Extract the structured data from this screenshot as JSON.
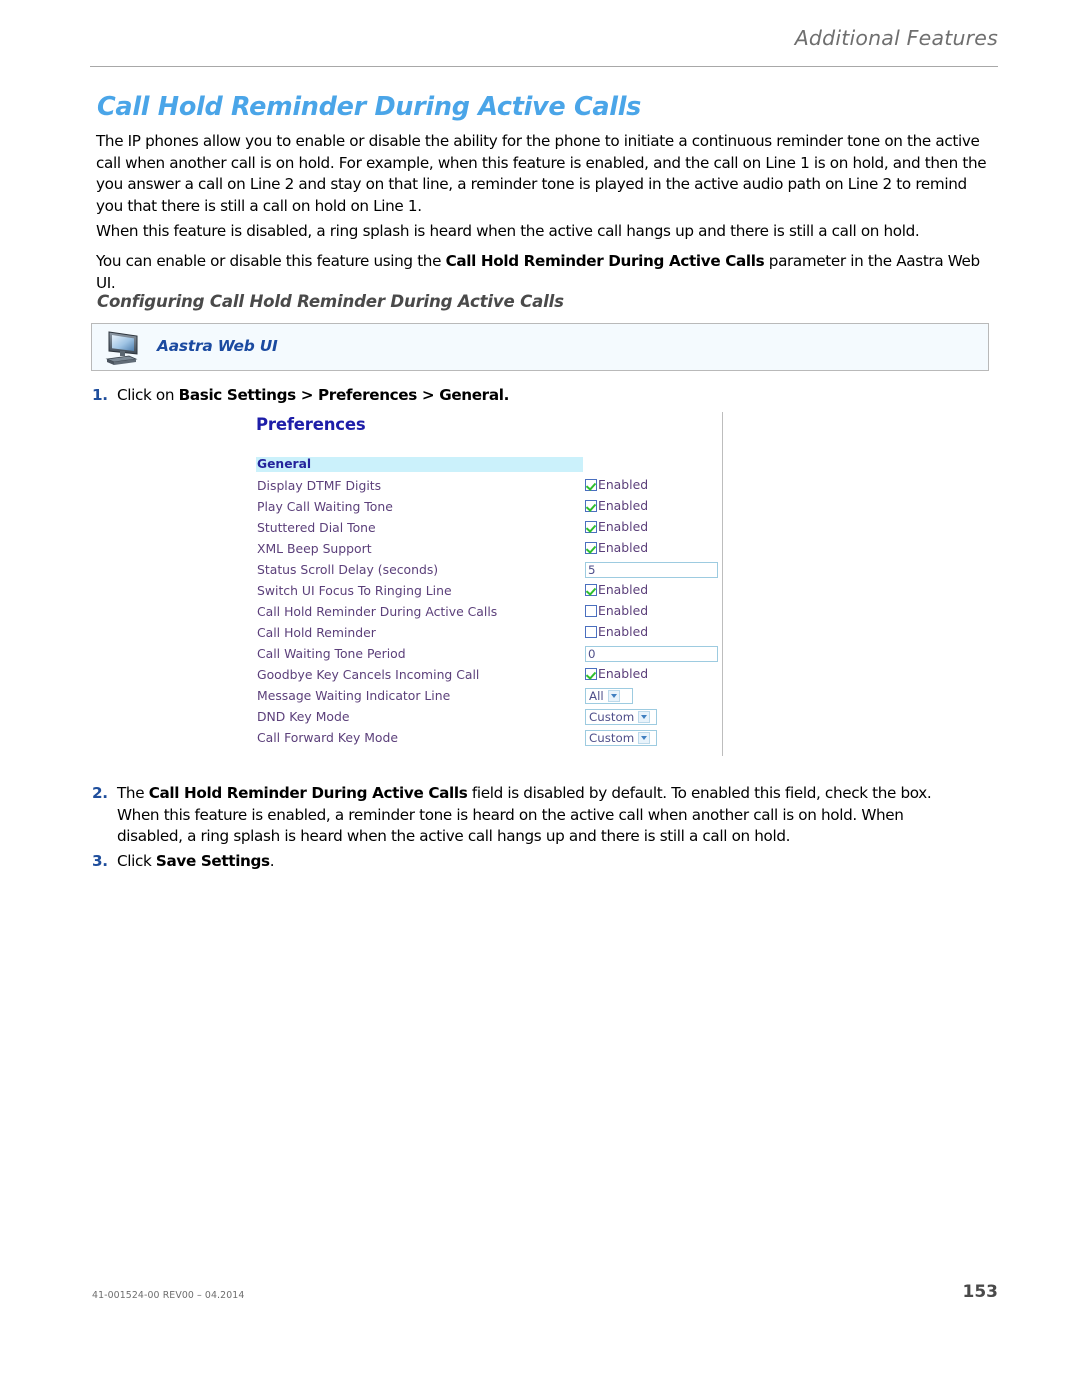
{
  "header": {
    "running_head": "Additional Features"
  },
  "title": "Call Hold Reminder During Active Calls",
  "paragraphs": {
    "p1_a": "The IP phones allow you to enable or disable the ability for the phone to initiate a continuous reminder tone on the active call when another call is on hold. For example, when this feature is enabled, and the call on Line 1 is on hold, and then the you answer a call on Line 2 and stay on that line, a reminder tone is played in the active audio path on Line 2 to remind you that there is still a call on hold on Line 1.",
    "p2": "When this feature is disabled, a ring splash is heard when the active call hangs up and there is still a call on hold.",
    "p3_a": "You can enable or disable this feature using the ",
    "p3_b": "Call Hold Reminder During Active Calls",
    "p3_c": " parameter in the Aastra Web UI."
  },
  "sub_heading": "Configuring Call Hold Reminder During Active Calls",
  "callout": {
    "label": "Aastra Web UI",
    "icon": "computer-monitor-icon"
  },
  "steps": {
    "step1": {
      "num": "1.",
      "a": "Click on ",
      "b": "Basic Settings > Preferences > General."
    },
    "step2": {
      "num": "2.",
      "a": "The ",
      "b": "Call Hold Reminder During Active Calls",
      "c": " field is disabled by default. To enabled this field, check the box.",
      "d": "When this feature is enabled, a reminder tone is heard on the active call when another call is on hold. When disabled, a ring splash is heard when the active call hangs up and there is still a call on hold."
    },
    "step3": {
      "num": "3.",
      "a": "Click ",
      "b": "Save Settings",
      "c": "."
    }
  },
  "screenshot": {
    "title": "Preferences",
    "section": "General",
    "enabled_label": "Enabled",
    "rows": [
      {
        "label": "Display DTMF Digits",
        "type": "checkbox",
        "checked": true
      },
      {
        "label": "Play Call Waiting Tone",
        "type": "checkbox",
        "checked": true
      },
      {
        "label": "Stuttered Dial Tone",
        "type": "checkbox",
        "checked": true
      },
      {
        "label": "XML Beep Support",
        "type": "checkbox",
        "checked": true
      },
      {
        "label": "Status Scroll Delay (seconds)",
        "type": "text",
        "value": "5"
      },
      {
        "label": "Switch UI Focus To Ringing Line",
        "type": "checkbox",
        "checked": true
      },
      {
        "label": "Call Hold Reminder During Active Calls",
        "type": "checkbox",
        "checked": false
      },
      {
        "label": "Call Hold Reminder",
        "type": "checkbox",
        "checked": false
      },
      {
        "label": "Call Waiting Tone Period",
        "type": "text",
        "value": "0"
      },
      {
        "label": "Goodbye Key Cancels Incoming Call",
        "type": "checkbox",
        "checked": true
      },
      {
        "label": "Message Waiting Indicator Line",
        "type": "select",
        "value": "All",
        "width": "all"
      },
      {
        "label": "DND Key Mode",
        "type": "select",
        "value": "Custom",
        "width": "custom"
      },
      {
        "label": "Call Forward Key Mode",
        "type": "select",
        "value": "Custom",
        "width": "custom"
      }
    ]
  },
  "footer": {
    "doc_id": "41-001524-00 REV00 – 04.2014",
    "page_number": "153"
  },
  "colors": {
    "title_blue": "#4aa5e8",
    "step_number_blue": "#1f4e9c",
    "callout_blue": "#1b4aa0",
    "screenshot_title": "#1d1da8",
    "section_bar": "#cbf1fb",
    "field_label": "#5b3f7a",
    "check_green": "#2fbf2f"
  }
}
